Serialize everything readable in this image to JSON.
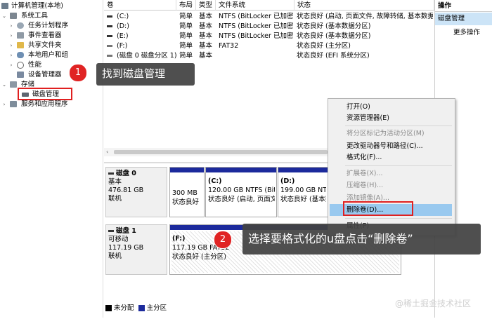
{
  "tree": {
    "root": "计算机管理(本地)",
    "system_tools": "系统工具",
    "task_scheduler": "任务计划程序",
    "event_viewer": "事件查看器",
    "shared_folders": "共享文件夹",
    "local_users": "本地用户和组",
    "performance": "性能",
    "device_manager": "设备管理器",
    "storage": "存储",
    "disk_management": "磁盘管理",
    "services_apps": "服务和应用程序"
  },
  "volumes": {
    "headers": [
      "卷",
      "布局",
      "类型",
      "文件系统",
      "状态"
    ],
    "rows": [
      {
        "name": "(C:)",
        "layout": "简单",
        "type": "基本",
        "fs": "NTFS (BitLocker 已加密)",
        "status": "状态良好 (启动, 页面文件, 故障转储, 基本数据分"
      },
      {
        "name": "(D:)",
        "layout": "简单",
        "type": "基本",
        "fs": "NTFS (BitLocker 已加密)",
        "status": "状态良好 (基本数据分区)"
      },
      {
        "name": "(E:)",
        "layout": "简单",
        "type": "基本",
        "fs": "NTFS (BitLocker 已加密)",
        "status": "状态良好 (基本数据分区)"
      },
      {
        "name": "(F:)",
        "layout": "简单",
        "type": "基本",
        "fs": "FAT32",
        "status": "状态良好 (主分区)"
      },
      {
        "name": "(磁盘 0 磁盘分区 1)",
        "layout": "简单",
        "type": "基本",
        "fs": "",
        "status": "状态良好 (EFI 系统分区)"
      }
    ]
  },
  "actions": {
    "header": "操作",
    "section": "磁盘管理",
    "more": "更多操作"
  },
  "disk0": {
    "name": "磁盘 0",
    "type": "基本",
    "size": "476.81 GB",
    "state": "联机",
    "parts": [
      {
        "title": "300 MB",
        "line2": "状态良好"
      },
      {
        "title": "(C:)",
        "line1": "120.00 GB NTFS (BitL",
        "line2": "状态良好 (启动, 页面文"
      },
      {
        "title": "(D:)",
        "line1": "199.00 GB NTFS (Bi",
        "line2": "状态良好 (基本数据"
      }
    ]
  },
  "disk1": {
    "name": "磁盘 1",
    "type": "可移动",
    "size": "117.19 GB",
    "state": "联机",
    "part": {
      "title": "(F:)",
      "line1": "117.19 GB FAT32",
      "line2": "状态良好 (主分区)"
    }
  },
  "legend": {
    "unallocated": "未分配",
    "primary": "主分区"
  },
  "menu": {
    "open": "打开(O)",
    "explorer": "资源管理器(E)",
    "mark_active": "将分区标记为活动分区(M)",
    "change_letter": "更改驱动器号和路径(C)...",
    "format": "格式化(F)...",
    "extend": "扩展卷(X)...",
    "shrink": "压缩卷(H)...",
    "mirror": "添加镜像(A)...",
    "delete": "删除卷(D)...",
    "properties": "属性(P)",
    "help": "帮助(H)"
  },
  "callouts": {
    "step1_num": "1",
    "step1_text": "找到磁盘管理",
    "step2_num": "2",
    "step2_text": "选择要格式化的u盘点击“删除卷”"
  },
  "watermark": "@稀土掘金技术社区",
  "colors": {
    "primary_partition": "#1c2a9c",
    "highlight": "#99c9ef",
    "callout_badge": "#e02424"
  }
}
